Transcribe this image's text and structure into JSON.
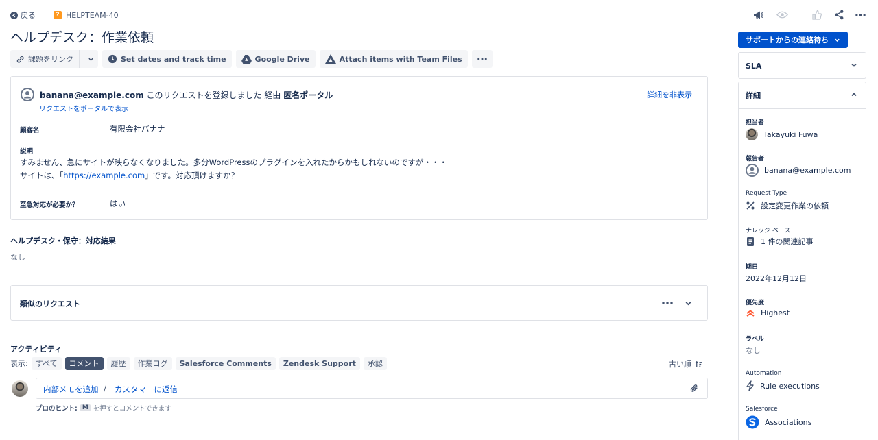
{
  "topbar": {
    "back_label": "戻る",
    "issue_key": "HELPTEAM-40"
  },
  "page_title": "ヘルプデスク：作業依頼",
  "toolbar": {
    "link_issue": "課題をリンク",
    "set_dates": "Set dates and track time",
    "google_drive": "Google Drive",
    "attach_items": "Attach items with Team Files"
  },
  "request": {
    "requester": "banana@example.com",
    "action_text": "このリクエストを登録しました 経由",
    "channel": "匿名ポータル",
    "view_in_portal": "リクエストをポータルで表示",
    "hide_details": "詳細を非表示",
    "fields": {
      "customer_label": "顧客名",
      "customer_value": "有限会社バナナ",
      "description_label": "説明",
      "description_line1": "すみません、急にサイトが映らなくなりました。多分WordPressのプラグインを入れたからかもしれないのですが・・・",
      "description_line2_prefix": "サイトは、「",
      "description_link": "https://example.com",
      "description_line2_suffix": "」です。対応頂けますか？",
      "urgent_label": "至急対応が必要か？",
      "urgent_value": "はい"
    }
  },
  "result_section": {
    "title": "ヘルプデスク・保守：対応結果",
    "value": "なし"
  },
  "similar_requests": {
    "title": "類似のリクエスト"
  },
  "activity": {
    "title": "アクティビティ",
    "show_label": "表示:",
    "tabs": [
      "すべて",
      "コメント",
      "履歴",
      "作業ログ",
      "Salesforce Comments",
      "Zendesk Support",
      "承認"
    ],
    "active_tab": "コメント",
    "sort_label": "古い順",
    "add_internal_note": "内部メモを追加",
    "divider": "/",
    "reply_to_customer": "カスタマーに返信",
    "tip_prefix": "プロのヒント:",
    "tip_key": "M",
    "tip_suffix": "を押すとコメントできます"
  },
  "sidebar": {
    "status_button": "サポートからの連絡待ち",
    "sla_label": "SLA",
    "details_label": "詳細",
    "assignee_label": "担当者",
    "assignee_value": "Takayuki Fuwa",
    "reporter_label": "報告者",
    "reporter_value": "banana@example.com",
    "request_type_label": "Request Type",
    "request_type_value": "設定変更作業の依頼",
    "knowledge_label": "ナレッジ ベース",
    "knowledge_value": "1 件の関連記事",
    "due_label": "期日",
    "due_value": "2022年12月12日",
    "priority_label": "優先度",
    "priority_value": "Highest",
    "labels_label": "ラベル",
    "labels_value": "なし",
    "automation_label": "Automation",
    "automation_value": "Rule executions",
    "salesforce_label": "Salesforce",
    "salesforce_value": "Associations"
  },
  "colors": {
    "brand": "#0052CC",
    "priority_highest": "#FF5630",
    "issue_type": "#FF991F",
    "salesforce": "#0B66E4"
  }
}
